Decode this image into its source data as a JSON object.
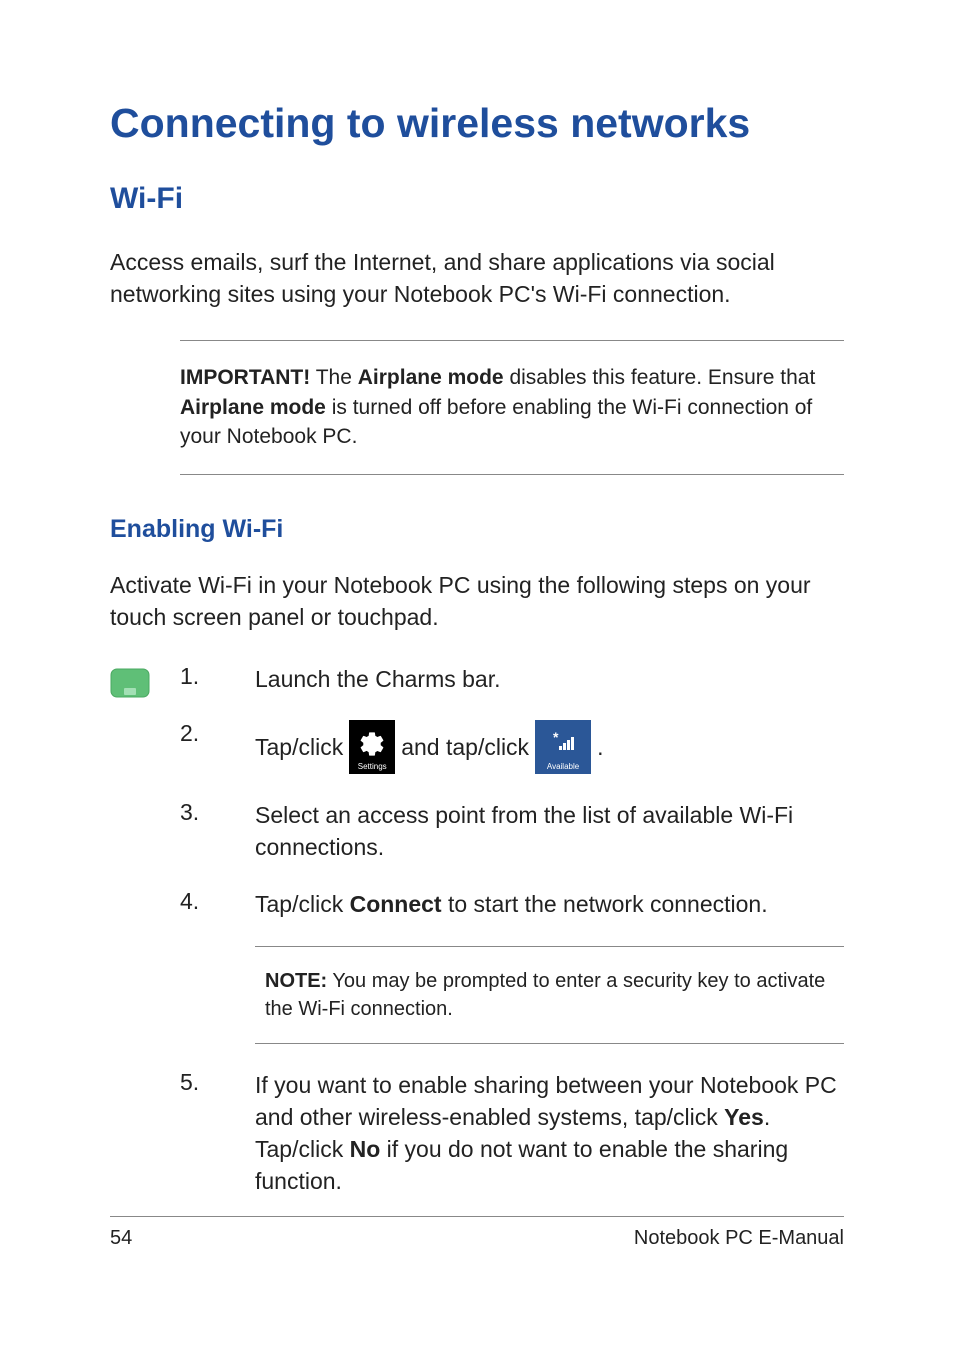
{
  "title": "Connecting to wireless networks",
  "section1": {
    "heading": "Wi-Fi",
    "intro": "Access emails, surf the Internet, and share applications via social networking sites using your Notebook PC's Wi-Fi connection.",
    "important_label": "IMPORTANT!",
    "important_text_part1": " The ",
    "important_bold1": "Airplane mode",
    "important_text_part2": " disables this feature. Ensure that ",
    "important_bold2": "Airplane mode",
    "important_text_part3": " is turned off before enabling the Wi-Fi connection of your Notebook PC."
  },
  "subsection": {
    "heading": "Enabling Wi-Fi",
    "intro": "Activate Wi-Fi in your Notebook PC using the following steps on your touch screen panel or touchpad."
  },
  "steps": {
    "s1_num": "1.",
    "s1_text": "Launch the Charms bar.",
    "s2_num": "2.",
    "s2_text_a": "Tap/click",
    "s2_text_b": "and tap/click",
    "s2_text_c": ".",
    "settings_label": "Settings",
    "available_label": "Available",
    "s3_num": "3.",
    "s3_text": "Select an access point from the list of available Wi-Fi connections.",
    "s4_num": "4.",
    "s4_text_a": "Tap/click ",
    "s4_bold": "Connect",
    "s4_text_b": " to start the network connection.",
    "note_label": "NOTE:",
    "note_text": " You may be prompted to enter a security key to activate the Wi-Fi connection.",
    "s5_num": "5.",
    "s5_text_a": "If you want to enable sharing between your Notebook PC and other wireless-enabled systems, tap/click ",
    "s5_bold1": "Yes",
    "s5_text_b": ". Tap/click ",
    "s5_bold2": "No",
    "s5_text_c": " if you do not want to enable the sharing function."
  },
  "footer": {
    "page_number": "54",
    "doc_title": "Notebook PC E-Manual"
  }
}
